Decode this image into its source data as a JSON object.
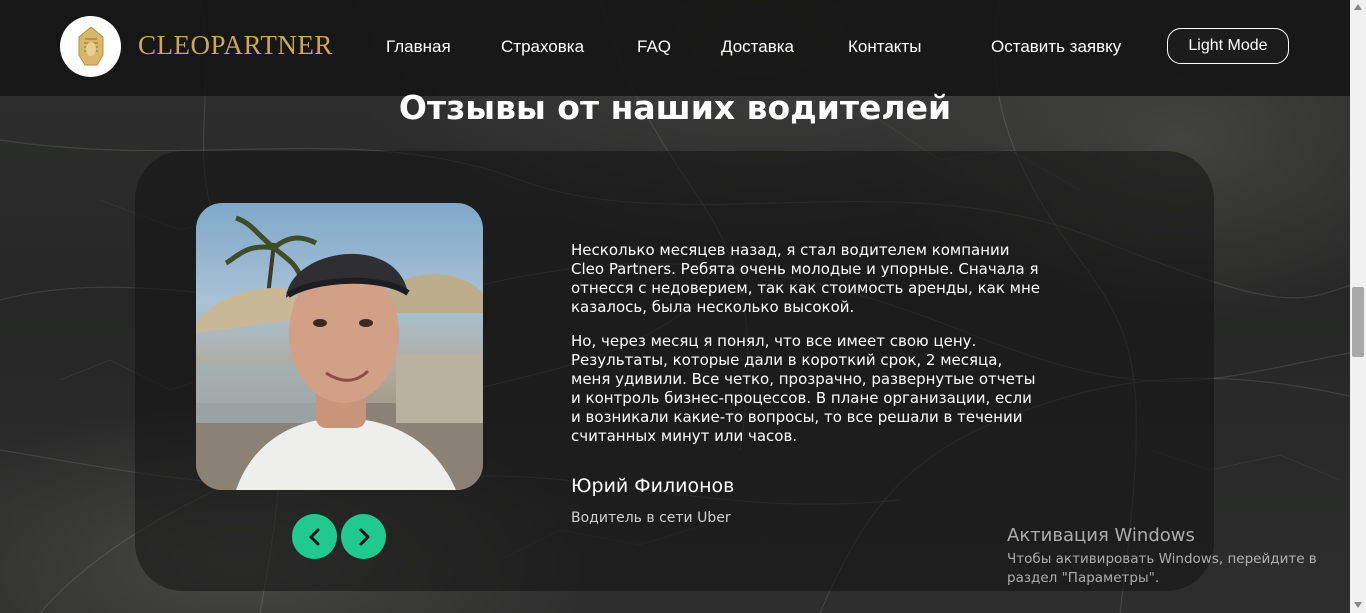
{
  "header": {
    "logo_text": "CLEOPARTNER",
    "nav": [
      "Главная",
      "Страховка",
      "FAQ",
      "Доставка",
      "Контакты",
      "Оставить заявку"
    ],
    "mode_button": "Light Mode"
  },
  "section": {
    "title": "Отзывы от наших водителей"
  },
  "review": {
    "paragraph1": "Несколько месяцев назад, я стал водителем компании Cleo Partners. Ребята очень молодые и упорные. Сначала я отнесся с недоверием, так как стоимость аренды, как мне казалось, была несколько высокой.",
    "paragraph2": "Но, через месяц я понял, что все имеет свою цену. Результаты, которые дали в короткий срок, 2 месяца, меня удивили. Все четко, прозрачно, развернутые отчеты и контроль бизнес-процессов. В плане организации, если и возникали какие-то вопросы, то все решали в течении считанных минут или часов.",
    "author": "Юрий Филионов",
    "role": "Водитель в сети Uber"
  },
  "carousel": {
    "prev_icon": "chevron-left-icon",
    "next_icon": "chevron-right-icon",
    "accent_color": "#20c98f"
  },
  "windows_activation": {
    "title": "Активация Windows",
    "subtitle": "Чтобы активировать Windows, перейдите в раздел \"Параметры\"."
  }
}
